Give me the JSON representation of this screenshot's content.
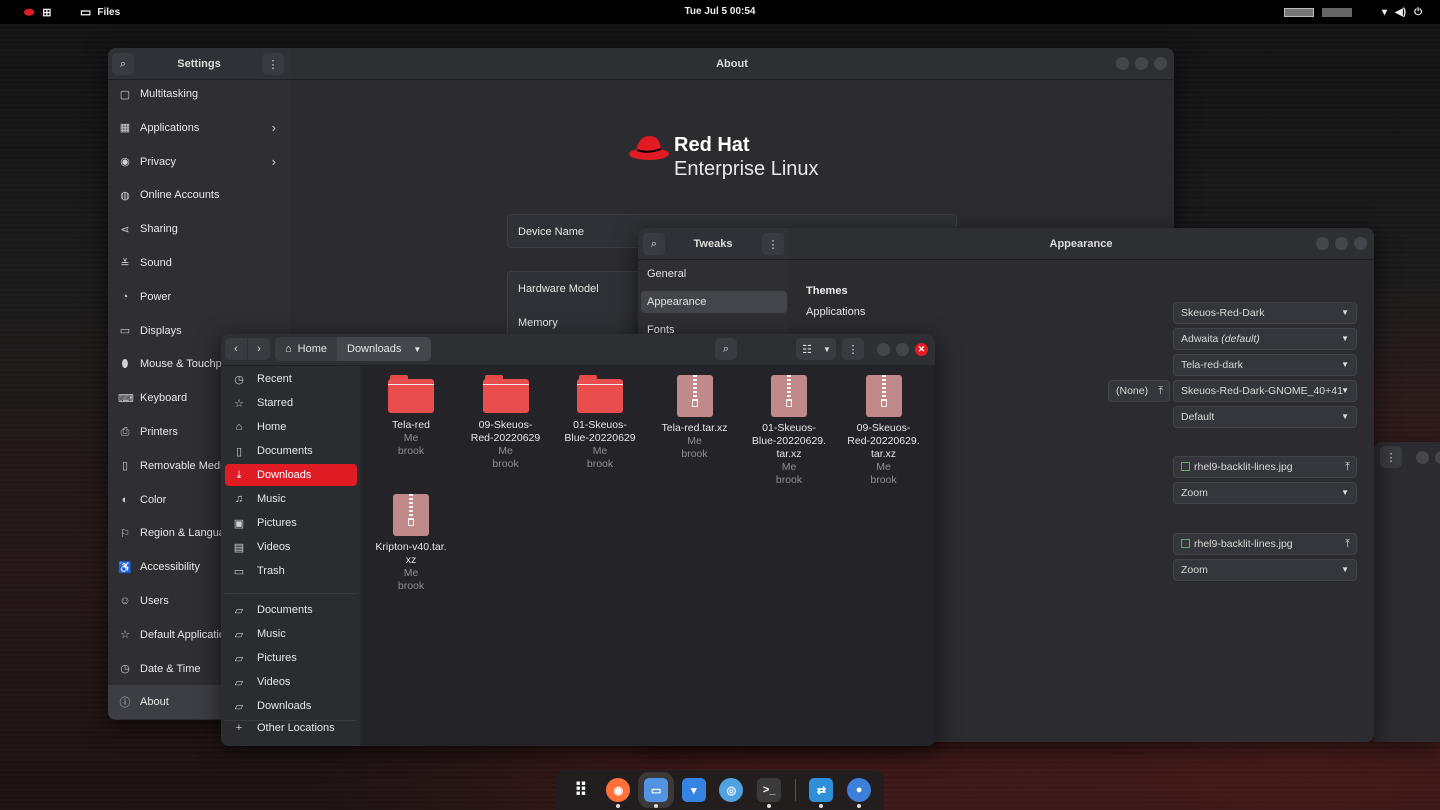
{
  "topbar": {
    "app_name": "Files",
    "clock": "Tue Jul 5  00:54"
  },
  "settings": {
    "title": "Settings",
    "page_title": "About",
    "sidebar": [
      {
        "label": "Multitasking",
        "icon": "multitasking-icon",
        "glyph": "▢",
        "chevron": false
      },
      {
        "label": "Applications",
        "icon": "applications-icon",
        "glyph": "▦",
        "chevron": true
      },
      {
        "label": "Privacy",
        "icon": "privacy-icon",
        "glyph": "◉",
        "chevron": true
      },
      {
        "label": "Online Accounts",
        "icon": "online-accounts-icon",
        "glyph": "◍",
        "chevron": false
      },
      {
        "label": "Sharing",
        "icon": "sharing-icon",
        "glyph": "⋖",
        "chevron": false
      },
      {
        "label": "Sound",
        "icon": "sound-icon",
        "glyph": "≚",
        "chevron": false
      },
      {
        "label": "Power",
        "icon": "power-icon",
        "glyph": "◔",
        "chevron": false
      },
      {
        "label": "Displays",
        "icon": "displays-icon",
        "glyph": "▭",
        "chevron": false
      },
      {
        "label": "Mouse & Touchpad",
        "icon": "mouse-icon",
        "glyph": "⬮",
        "chevron": false
      },
      {
        "label": "Keyboard",
        "icon": "keyboard-icon",
        "glyph": "⌨",
        "chevron": false
      },
      {
        "label": "Printers",
        "icon": "printer-icon",
        "glyph": "⎙",
        "chevron": false
      },
      {
        "label": "Removable Media",
        "icon": "removable-media-icon",
        "glyph": "▯",
        "chevron": false
      },
      {
        "label": "Color",
        "icon": "color-icon",
        "glyph": "◐",
        "chevron": false
      },
      {
        "label": "Region & Language",
        "icon": "region-icon",
        "glyph": "⚐",
        "chevron": false
      },
      {
        "label": "Accessibility",
        "icon": "accessibility-icon",
        "glyph": "♿",
        "chevron": false
      },
      {
        "label": "Users",
        "icon": "users-icon",
        "glyph": "☺",
        "chevron": false
      },
      {
        "label": "Default Applications",
        "icon": "default-apps-icon",
        "glyph": "☆",
        "chevron": false
      },
      {
        "label": "Date & Time",
        "icon": "date-time-icon",
        "glyph": "◷",
        "chevron": false
      },
      {
        "label": "About",
        "icon": "about-icon",
        "glyph": "ⓘ",
        "chevron": false
      }
    ],
    "about": {
      "logo_line1": "Red Hat",
      "logo_line2": "Enterprise Linux",
      "device_name_label": "Device Name",
      "hardware_model_label": "Hardware Model",
      "memory_label": "Memory"
    }
  },
  "tweaks": {
    "title": "Tweaks",
    "page_title": "Appearance",
    "sidebar": [
      "General",
      "Appearance",
      "Fonts"
    ],
    "themes_heading": "Themes",
    "applications_label": "Applications",
    "dropdowns": {
      "applications": "Skeuos-Red-Dark",
      "cursor": "Adwaita",
      "cursor_suffix": "(default)",
      "icons": "Tela-red-dark",
      "shell": "Skeuos-Red-Dark-GNOME_40+41",
      "sound": "Default",
      "background_image": "rhel9-backlit-lines.jpg",
      "background_adjust": "Zoom",
      "lock_image": "rhel9-backlit-lines.jpg",
      "lock_adjust": "Zoom"
    },
    "none_button": "(None)"
  },
  "files": {
    "path": [
      "Home",
      "Downloads"
    ],
    "sidebar": [
      {
        "label": "Recent",
        "glyph": "◷",
        "name": "sidebar-item-recent"
      },
      {
        "label": "Starred",
        "glyph": "☆",
        "name": "sidebar-item-starred"
      },
      {
        "label": "Home",
        "glyph": "⌂",
        "name": "sidebar-item-home"
      },
      {
        "label": "Documents",
        "glyph": "▯",
        "name": "sidebar-item-documents"
      },
      {
        "label": "Downloads",
        "glyph": "⤓",
        "name": "sidebar-item-downloads"
      },
      {
        "label": "Music",
        "glyph": "♫",
        "name": "sidebar-item-music"
      },
      {
        "label": "Pictures",
        "glyph": "▣",
        "name": "sidebar-item-pictures"
      },
      {
        "label": "Videos",
        "glyph": "▤",
        "name": "sidebar-item-videos"
      },
      {
        "label": "Trash",
        "glyph": "▭",
        "name": "sidebar-item-trash"
      }
    ],
    "bookmarks": [
      {
        "label": "Documents",
        "glyph": "▱",
        "name": "bookmark-documents"
      },
      {
        "label": "Music",
        "glyph": "▱",
        "name": "bookmark-music"
      },
      {
        "label": "Pictures",
        "glyph": "▱",
        "name": "bookmark-pictures"
      },
      {
        "label": "Videos",
        "glyph": "▱",
        "name": "bookmark-videos"
      },
      {
        "label": "Downloads",
        "glyph": "▱",
        "name": "bookmark-downloads"
      }
    ],
    "other_locations": "Other Locations",
    "items": [
      {
        "type": "folder",
        "name_lines": [
          "Tela-red"
        ],
        "meta_lines": [
          "Me",
          "brook"
        ]
      },
      {
        "type": "folder",
        "name_lines": [
          "09-Skeuos-",
          "Red-20220629"
        ],
        "meta_lines": [
          "Me",
          "brook"
        ]
      },
      {
        "type": "folder",
        "name_lines": [
          "01-Skeuos-",
          "Blue-20220629"
        ],
        "meta_lines": [
          "Me",
          "brook"
        ]
      },
      {
        "type": "archive",
        "name_lines": [
          "Tela-red.tar.xz"
        ],
        "meta_lines": [
          "Me",
          "brook"
        ]
      },
      {
        "type": "archive",
        "name_lines": [
          "01-Skeuos-",
          "Blue-20220629.",
          "tar.xz"
        ],
        "meta_lines": [
          "Me",
          "brook"
        ]
      },
      {
        "type": "archive",
        "name_lines": [
          "09-Skeuos-",
          "Red-20220629.",
          "tar.xz"
        ],
        "meta_lines": [
          "Me",
          "brook"
        ]
      },
      {
        "type": "archive",
        "name_lines": [
          "Kripton-v40.tar.",
          "xz"
        ],
        "meta_lines": [
          "Me",
          "brook"
        ]
      }
    ]
  },
  "dock": [
    {
      "name": "app-grid-icon",
      "color": "#000000",
      "running": false
    },
    {
      "name": "firefox-icon",
      "color": "#ff7139",
      "running": true
    },
    {
      "name": "files-icon",
      "color": "#5294e2",
      "running": true
    },
    {
      "name": "software-icon",
      "color": "#3584e4",
      "running": false
    },
    {
      "name": "help-icon",
      "color": "#4fa3e0",
      "running": false
    },
    {
      "name": "terminal-icon",
      "color": "#3a3a3a",
      "running": true
    },
    {
      "name": "tweaks-icon",
      "color": "#2f8fd8",
      "running": true
    },
    {
      "name": "settings-icon",
      "color": "#3d7fd9",
      "running": true
    }
  ],
  "colors": {
    "accent": "#e01b24",
    "folder": "#ea4d4d",
    "archive": "#c08a8a"
  }
}
